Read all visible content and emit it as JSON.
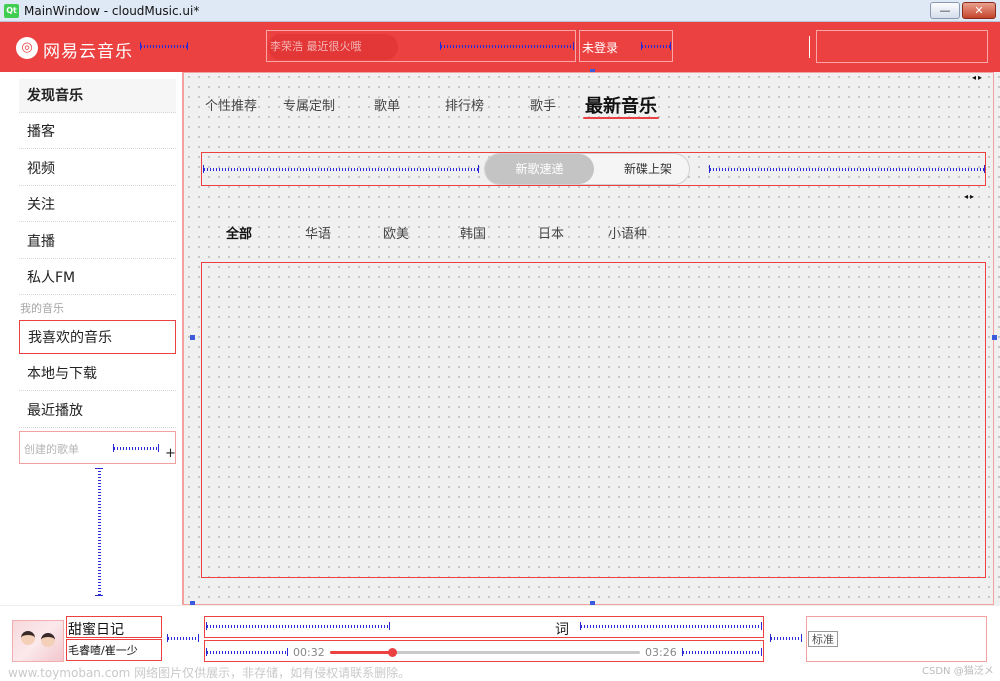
{
  "window": {
    "title": "MainWindow - cloudMusic.ui*",
    "logo": "Qt",
    "minimize": "—",
    "close": "✕"
  },
  "header": {
    "logo_glyph": "◎",
    "logo_text": "网易云音乐",
    "search_placeholder": "李荣浩 最近很火哦",
    "login_text": "未登录"
  },
  "sidebar": {
    "items": [
      {
        "label": "发现音乐"
      },
      {
        "label": "播客"
      },
      {
        "label": "视频"
      },
      {
        "label": "关注"
      },
      {
        "label": "直播"
      },
      {
        "label": "私人FM"
      }
    ],
    "my_music_label": "我的音乐",
    "my_items": [
      {
        "label": "我喜欢的音乐"
      },
      {
        "label": "本地与下载"
      },
      {
        "label": "最近播放"
      }
    ],
    "created_label": "创建的歌单",
    "created_add": "+"
  },
  "main": {
    "tabs": [
      {
        "label": "个性推荐"
      },
      {
        "label": "专属定制"
      },
      {
        "label": "歌单"
      },
      {
        "label": "排行榜"
      },
      {
        "label": "歌手"
      },
      {
        "label": "最新音乐"
      }
    ],
    "toggle": {
      "new_songs": "新歌速递",
      "new_albums": "新碟上架"
    },
    "regions": [
      {
        "label": "全部"
      },
      {
        "label": "华语"
      },
      {
        "label": "欧美"
      },
      {
        "label": "韩国"
      },
      {
        "label": "日本"
      },
      {
        "label": "小语种"
      }
    ],
    "scroll_arrows": "◂▸"
  },
  "player": {
    "song_title": "甜蜜日记",
    "song_artist": "毛睿喳/崔一少",
    "lyrics_label": "词",
    "time_current": "00:32",
    "time_total": "03:26",
    "progress": 0.2,
    "quality_label": "标准"
  },
  "overlay": {
    "watermark": "www.toymoban.com 网络图片仅供展示，非存储，如有侵权请联系删除。",
    "csdn": "CSDN @猫泛メ"
  },
  "colors": {
    "accent": "#ec4141",
    "spacer": "#2b2bd6",
    "handle": "#3b5bdb"
  }
}
